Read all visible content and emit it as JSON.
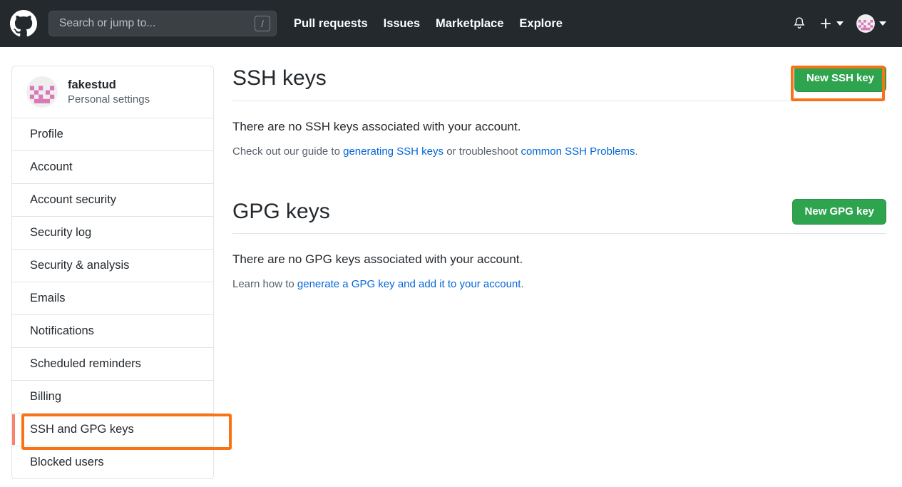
{
  "header": {
    "logo_icon": "github-mark-icon",
    "search": {
      "placeholder": "Search or jump to...",
      "shortcut_badge": "/"
    },
    "nav": [
      {
        "label": "Pull requests"
      },
      {
        "label": "Issues"
      },
      {
        "label": "Marketplace"
      },
      {
        "label": "Explore"
      }
    ],
    "notifications_icon": "bell-icon",
    "create_new_icon": "plus-icon",
    "avatar_icon": "user-avatar-identicon",
    "background_color": "#24292e"
  },
  "sidebar": {
    "profile": {
      "username": "fakestud",
      "subtitle": "Personal settings",
      "avatar_icon": "user-avatar-identicon"
    },
    "items": [
      {
        "label": "Profile",
        "selected": false
      },
      {
        "label": "Account",
        "selected": false
      },
      {
        "label": "Account security",
        "selected": false
      },
      {
        "label": "Security log",
        "selected": false
      },
      {
        "label": "Security & analysis",
        "selected": false
      },
      {
        "label": "Emails",
        "selected": false
      },
      {
        "label": "Notifications",
        "selected": false
      },
      {
        "label": "Scheduled reminders",
        "selected": false
      },
      {
        "label": "Billing",
        "selected": false
      },
      {
        "label": "SSH and GPG keys",
        "selected": true
      },
      {
        "label": "Blocked users",
        "selected": false
      }
    ],
    "selected_indicator_color": "#f9826c"
  },
  "main": {
    "ssh": {
      "title": "SSH keys",
      "button_label": "New SSH key",
      "empty_message": "There are no SSH keys associated with your account.",
      "help_prefix": "Check out our guide to ",
      "help_link_1": "generating SSH keys",
      "help_middle": " or troubleshoot ",
      "help_link_2": "common SSH Problems",
      "help_suffix": "."
    },
    "gpg": {
      "title": "GPG keys",
      "button_label": "New GPG key",
      "empty_message": "There are no GPG keys associated with your account.",
      "help_prefix": "Learn how to ",
      "help_link_1": "generate a GPG key and add it to your account",
      "help_suffix": "."
    }
  },
  "annotations": {
    "color": "#f97316",
    "targets": [
      "SSH and GPG keys",
      "New SSH key"
    ]
  },
  "colors": {
    "green_button": "#2ea44f",
    "link_blue": "#0366d6",
    "header_bg": "#24292e",
    "border": "#e1e4e8",
    "annotation_orange": "#f97316"
  }
}
